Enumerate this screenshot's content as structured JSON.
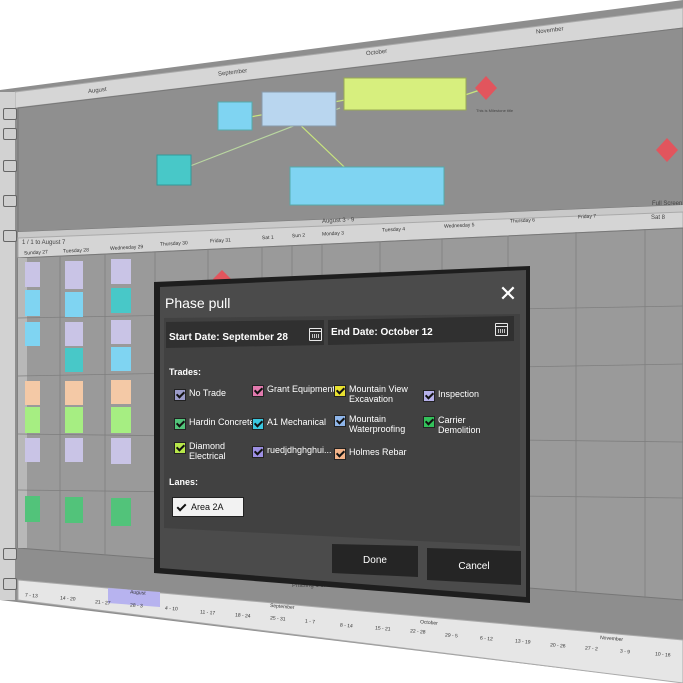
{
  "background": {
    "months_top": [
      "August",
      "September",
      "October",
      "November"
    ],
    "week_header": "August 3 - 9",
    "pull_screen": "Full Screen",
    "sat_label": "Sat 8",
    "range_label": "1 / 1 to August 7",
    "days": [
      "Sunday 27",
      "Tuesday 28",
      "Wednesday 29",
      "Thursday 30",
      "Friday 31",
      "Sat 1",
      "Sun 2",
      "Monday 3",
      "Tuesday 4",
      "Wednesday 5",
      "Thursday 6",
      "Friday 7"
    ],
    "milestone_label": "This is Milestone title",
    "phase_label": "Phasing 1 of",
    "bottom_months": [
      "August",
      "September",
      "October",
      "November"
    ],
    "bottom_ticks": [
      "7 - 13",
      "14 - 20",
      "21 - 27",
      "28 - 3",
      "4 - 10",
      "11 - 17",
      "18 - 24",
      "25 - 31",
      "1 - 7",
      "8 - 14",
      "15 - 21",
      "22 - 28",
      "29 - 5",
      "6 - 12",
      "13 - 19",
      "20 - 26",
      "27 - 2",
      "3 - 9",
      "10 - 16"
    ],
    "colors": {
      "panel": "#8d8d8d",
      "grid": "#9a9a9a",
      "header": "#c8c8c8",
      "blue": "#7fd4f2",
      "green": "#d7ef7e",
      "lightblue": "#b9d6ef",
      "red": "#e2555d",
      "teal": "#48c8c8",
      "lime": "#a6ee82",
      "peach": "#f4c9a6",
      "lavender": "#c9c4e6"
    }
  },
  "dialog": {
    "title": "Phase pull",
    "close_icon": "close-icon",
    "start_date_label": "Start Date: September 28",
    "end_date_label": "End Date: October 12",
    "trades_label": "Trades:",
    "lanes_label": "Lanes:",
    "trades": [
      {
        "label": "No Trade",
        "color": "#9b9bc9"
      },
      {
        "label": "Grant Equipment",
        "color": "#e27aae"
      },
      {
        "label": "Mountain View Excavation",
        "color": "#e8e030"
      },
      {
        "label": "Inspection",
        "color": "#b5b0ea"
      },
      {
        "label": "Hardin Concrete",
        "color": "#52c37a"
      },
      {
        "label": "A1 Mechanical",
        "color": "#3ac7e0"
      },
      {
        "label": "Mountain Waterproofing",
        "color": "#8fb6ea"
      },
      {
        "label": "Carrier Demolition",
        "color": "#33c15a"
      },
      {
        "label": "Diamond Electrical",
        "color": "#b7e64a"
      },
      {
        "label": "ruedjdhghghui...",
        "color": "#9d90e4"
      },
      {
        "label": "Holmes Rebar",
        "color": "#f2b389"
      }
    ],
    "lanes": [
      {
        "label": "Area 2A"
      }
    ],
    "done_label": "Done",
    "cancel_label": "Cancel",
    "colors": {
      "body": "#4a4a4a",
      "inner": "#3a3a3a",
      "field": "#333333",
      "button": "#262626",
      "frame": "#1d1d1d"
    }
  }
}
